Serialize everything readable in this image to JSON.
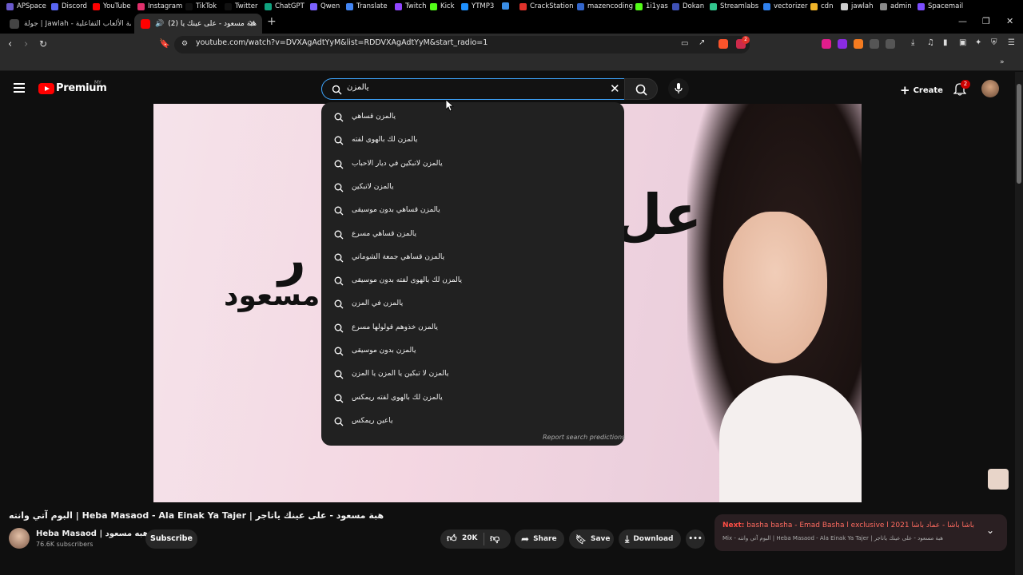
{
  "browser": {
    "tabs": [
      {
        "title": "جولة | Jawlah - منصة الألعاب التفاعلية",
        "active": false
      },
      {
        "title": "(2) هبة مسعود - على عينك يا",
        "active": true
      }
    ],
    "url": "youtube.com/watch?v=DVXAgAdtYyM&list=RDDVXAgAdtYyM&start_radio=1",
    "extension_badge": "2",
    "bookmarks": [
      "APSpace",
      "Discord",
      "YouTube",
      "Instagram",
      "TikTok",
      "Twitter",
      "ChatGPT",
      "Qwen",
      "Translate",
      "Twitch",
      "Kick",
      "YTMP3",
      "",
      "CrackStation",
      "mazencoding",
      "1i1yas",
      "Dokan",
      "Streamlabs",
      "vectorizer",
      "cdn",
      "jawlah",
      "admin",
      "Spacemail"
    ],
    "bookmark_colors": [
      "#6a5acd",
      "#5865f2",
      "#ff0000",
      "#e1306c",
      "#111111",
      "#111111",
      "#10a37f",
      "#7b61ff",
      "#4285f4",
      "#9146ff",
      "#53fc18",
      "#1e90ff",
      "#3a8ee6",
      "#e0322b",
      "#3366cc",
      "#53fc18",
      "#3f51b5",
      "#31c48d",
      "#2f80ed",
      "#f0b429",
      "#cccccc",
      "#888888",
      "#7c4dff"
    ]
  },
  "youtube": {
    "logo_text": "Premium",
    "region": "MY",
    "search_value": "يالمزن",
    "create_label": "Create",
    "notification_count": "2",
    "suggestions": [
      "يالمزن قساهي",
      "يالمزن لك بالهوى لفته",
      "يالمزن لاتبكين في ديار الاحباب",
      "يالمزن لاتبكين",
      "يالمزن قساهي بدون موسيقى",
      "يالمزن قساهي مسرع",
      "يالمزن قساهي جمعة الشوماني",
      "يالمزن لك بالهوى لفته بدون موسيقى",
      "يالمزن في المزن",
      "يالمزن خذوهم قولولها مسرع",
      "يالمزن بدون موسيقى",
      "يالمزن لا تبكين يا المزن يا المزن",
      "يالمزن لك بالهوى لفته ريمكس",
      "ياعين ريمكس"
    ],
    "report_label": "Report search predictions"
  },
  "video": {
    "thumbnail_text_1": "عل",
    "thumbnail_text_2": "ر",
    "thumbnail_text_3": "مسعود",
    "title": "البوم آتي وانته | Heba Masaod - Ala Einak Ya Tajer | هبة مسعود - على عينك ياتاجر",
    "channel_name": "Heba Masaod | هبه مسعود",
    "subscribers": "76.6K subscribers",
    "subscribe_label": "Subscribe",
    "likes": "20K",
    "share_label": "Share",
    "save_label": "Save",
    "download_label": "Download",
    "next_label": "Next:",
    "next_title": "basha basha - Emad Basha l exclusive l 2021 باشا باشا - عماد باشا",
    "next_sub": "Mix - البوم آتي وانته | Heba Masaod - Ala Einak Ya Tajer | هبة مسعود - على عينك ياتاجر"
  },
  "colors": {
    "accent_red": "#ff0000",
    "search_focus": "#3ea6ff",
    "next_label": "#ff4e45"
  }
}
